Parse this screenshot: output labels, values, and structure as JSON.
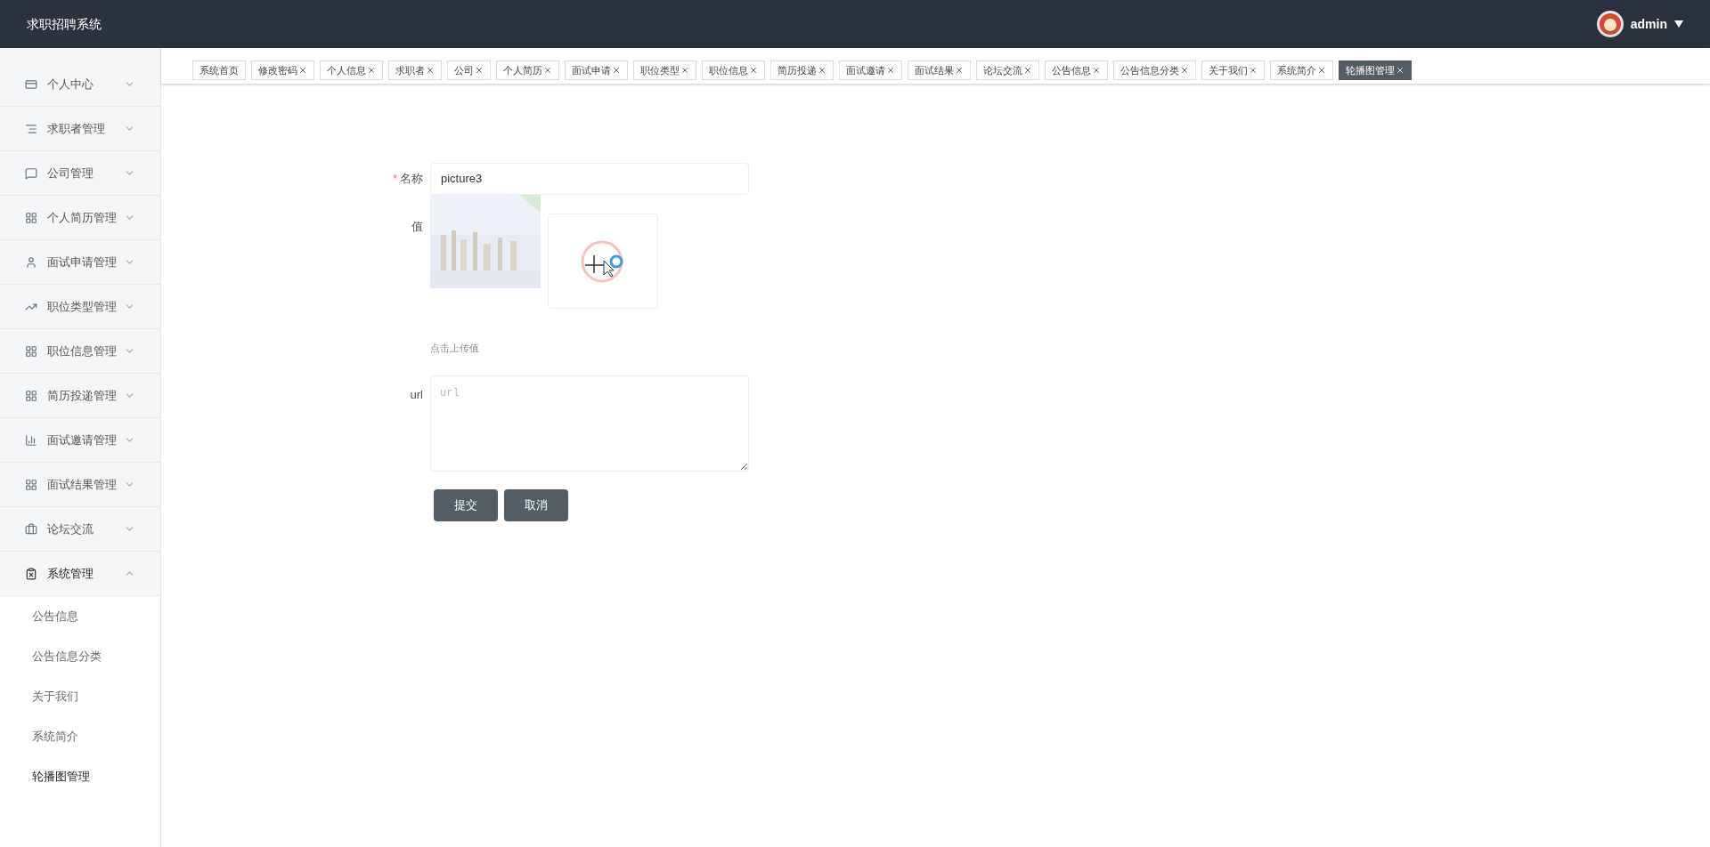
{
  "header": {
    "title": "求职招聘系统",
    "user": "admin"
  },
  "sidebar": {
    "items": [
      {
        "label": "个人中心",
        "expanded": false
      },
      {
        "label": "求职者管理",
        "expanded": false
      },
      {
        "label": "公司管理",
        "expanded": false
      },
      {
        "label": "个人简历管理",
        "expanded": false
      },
      {
        "label": "面试申请管理",
        "expanded": false
      },
      {
        "label": "职位类型管理",
        "expanded": false
      },
      {
        "label": "职位信息管理",
        "expanded": false
      },
      {
        "label": "简历投递管理",
        "expanded": false
      },
      {
        "label": "面试邀请管理",
        "expanded": false
      },
      {
        "label": "面试结果管理",
        "expanded": false
      },
      {
        "label": "论坛交流",
        "expanded": false
      },
      {
        "label": "系统管理",
        "expanded": true,
        "children": [
          {
            "label": "公告信息",
            "selected": false
          },
          {
            "label": "公告信息分类",
            "selected": false
          },
          {
            "label": "关于我们",
            "selected": false
          },
          {
            "label": "系统简介",
            "selected": false
          },
          {
            "label": "轮播图管理",
            "selected": true
          }
        ]
      }
    ]
  },
  "tabs": [
    {
      "label": "系统首页",
      "closable": false,
      "selected": false
    },
    {
      "label": "修改密码",
      "closable": true,
      "selected": false
    },
    {
      "label": "个人信息",
      "closable": true,
      "selected": false
    },
    {
      "label": "求职者",
      "closable": true,
      "selected": false
    },
    {
      "label": "公司",
      "closable": true,
      "selected": false
    },
    {
      "label": "个人简历",
      "closable": true,
      "selected": false
    },
    {
      "label": "面试申请",
      "closable": true,
      "selected": false
    },
    {
      "label": "职位类型",
      "closable": true,
      "selected": false
    },
    {
      "label": "职位信息",
      "closable": true,
      "selected": false
    },
    {
      "label": "简历投递",
      "closable": true,
      "selected": false
    },
    {
      "label": "面试邀请",
      "closable": true,
      "selected": false
    },
    {
      "label": "面试结果",
      "closable": true,
      "selected": false
    },
    {
      "label": "论坛交流",
      "closable": true,
      "selected": false
    },
    {
      "label": "公告信息",
      "closable": true,
      "selected": false
    },
    {
      "label": "公告信息分类",
      "closable": true,
      "selected": false
    },
    {
      "label": "关于我们",
      "closable": true,
      "selected": false
    },
    {
      "label": "系统简介",
      "closable": true,
      "selected": false
    },
    {
      "label": "轮播图管理",
      "closable": true,
      "selected": true
    }
  ],
  "form": {
    "name": {
      "label": "名称",
      "required_mark": "*",
      "value": "picture3"
    },
    "value": {
      "label": "值",
      "hint": "点击上传值"
    },
    "url": {
      "label": "url",
      "placeholder": "url"
    },
    "buttons": [
      "提交",
      "取消"
    ]
  }
}
